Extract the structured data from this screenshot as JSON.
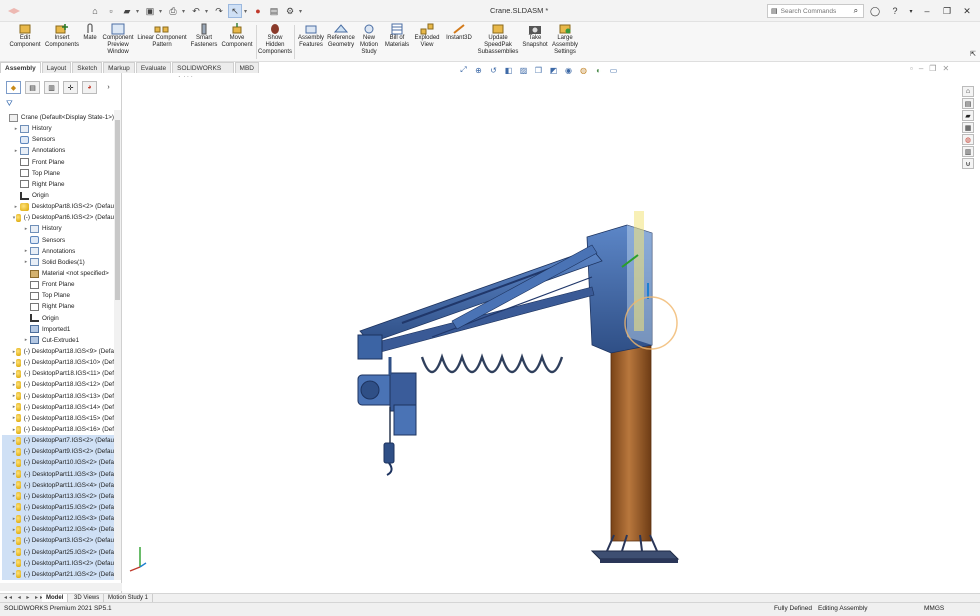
{
  "window": {
    "title": "Crane.SLDASM *"
  },
  "search": {
    "placeholder": "Search Commands"
  },
  "commands": [
    {
      "label": "Edit\nComponent"
    },
    {
      "label": "Insert\nComponents"
    },
    {
      "label": "Mate"
    },
    {
      "label": "Component\nPreview\nWindow"
    },
    {
      "label": "Linear Component\nPattern"
    },
    {
      "label": "Smart\nFasteners"
    },
    {
      "label": "Move\nComponent"
    },
    {
      "label": "Show\nHidden\nComponents"
    },
    {
      "label": "Assembly\nFeatures"
    },
    {
      "label": "Reference\nGeometry"
    },
    {
      "label": "New\nMotion\nStudy"
    },
    {
      "label": "Bill of\nMaterials"
    },
    {
      "label": "Exploded\nView"
    },
    {
      "label": "Instant3D"
    },
    {
      "label": "Update\nSpeedPak\nSubassemblies"
    },
    {
      "label": "Take\nSnapshot"
    },
    {
      "label": "Large\nAssembly\nSettings"
    }
  ],
  "tabs": [
    "Assembly",
    "Layout",
    "Sketch",
    "Markup",
    "Evaluate",
    "SOLIDWORKS Add-Ins",
    "MBD"
  ],
  "tree": [
    {
      "label": "Crane  (Default<Display State-1>)",
      "icon": "assembly",
      "exp": "",
      "indent": 0,
      "sel": false
    },
    {
      "label": "History",
      "icon": "folder",
      "exp": "▸",
      "indent": 1,
      "sel": false
    },
    {
      "label": "Sensors",
      "icon": "sensor",
      "exp": "",
      "indent": 1,
      "sel": false
    },
    {
      "label": "Annotations",
      "icon": "folder",
      "exp": "▸",
      "indent": 1,
      "sel": false
    },
    {
      "label": "Front Plane",
      "icon": "plane",
      "exp": "",
      "indent": 1,
      "sel": false
    },
    {
      "label": "Top Plane",
      "icon": "plane",
      "exp": "",
      "indent": 1,
      "sel": false
    },
    {
      "label": "Right Plane",
      "icon": "plane",
      "exp": "",
      "indent": 1,
      "sel": false
    },
    {
      "label": "Origin",
      "icon": "origin",
      "exp": "",
      "indent": 1,
      "sel": false
    },
    {
      "label": "DesktopPart8.IGS<2> (Defau",
      "icon": "part",
      "exp": "▸",
      "indent": 1,
      "sel": false
    },
    {
      "label": "(-) DesktopPart6.IGS<2> (Defau",
      "icon": "part",
      "exp": "▾",
      "indent": 1,
      "sel": false
    },
    {
      "label": "History",
      "icon": "folder",
      "exp": "▸",
      "indent": 2,
      "sel": false
    },
    {
      "label": "Sensors",
      "icon": "sensor",
      "exp": "",
      "indent": 2,
      "sel": false
    },
    {
      "label": "Annotations",
      "icon": "folder",
      "exp": "▸",
      "indent": 2,
      "sel": false
    },
    {
      "label": "Solid Bodies(1)",
      "icon": "folder",
      "exp": "▸",
      "indent": 2,
      "sel": false
    },
    {
      "label": "Material <not specified>",
      "icon": "mat",
      "exp": "",
      "indent": 2,
      "sel": false
    },
    {
      "label": "Front Plane",
      "icon": "plane",
      "exp": "",
      "indent": 2,
      "sel": false
    },
    {
      "label": "Top Plane",
      "icon": "plane",
      "exp": "",
      "indent": 2,
      "sel": false
    },
    {
      "label": "Right Plane",
      "icon": "plane",
      "exp": "",
      "indent": 2,
      "sel": false
    },
    {
      "label": "Origin",
      "icon": "origin",
      "exp": "",
      "indent": 2,
      "sel": false
    },
    {
      "label": "Imported1",
      "icon": "feat",
      "exp": "",
      "indent": 2,
      "sel": false
    },
    {
      "label": "Cut-Extrude1",
      "icon": "feat",
      "exp": "▸",
      "indent": 2,
      "sel": false
    },
    {
      "label": "(-) DesktopPart18.IGS<9> (Defa",
      "icon": "part",
      "exp": "▸",
      "indent": 1,
      "sel": false
    },
    {
      "label": "(-) DesktopPart18.IGS<10> (Def",
      "icon": "part",
      "exp": "▸",
      "indent": 1,
      "sel": false
    },
    {
      "label": "(-) DesktopPart18.IGS<11> (Def",
      "icon": "part",
      "exp": "▸",
      "indent": 1,
      "sel": false
    },
    {
      "label": "(-) DesktopPart18.IGS<12> (Def",
      "icon": "part",
      "exp": "▸",
      "indent": 1,
      "sel": false
    },
    {
      "label": "(-) DesktopPart18.IGS<13> (Def",
      "icon": "part",
      "exp": "▸",
      "indent": 1,
      "sel": false
    },
    {
      "label": "(-) DesktopPart18.IGS<14> (Def",
      "icon": "part",
      "exp": "▸",
      "indent": 1,
      "sel": false
    },
    {
      "label": "(-) DesktopPart18.IGS<15> (Def",
      "icon": "part",
      "exp": "▸",
      "indent": 1,
      "sel": false
    },
    {
      "label": "(-) DesktopPart18.IGS<16> (Def",
      "icon": "part",
      "exp": "▸",
      "indent": 1,
      "sel": false
    },
    {
      "label": "(-) DesktopPart7.IGS<2> (Defau",
      "icon": "part",
      "exp": "▸",
      "indent": 1,
      "sel": true
    },
    {
      "label": "(-) DesktopPart9.IGS<2> (Defau",
      "icon": "part",
      "exp": "▸",
      "indent": 1,
      "sel": true
    },
    {
      "label": "(-) DesktopPart10.IGS<2> (Defa",
      "icon": "part",
      "exp": "▸",
      "indent": 1,
      "sel": true
    },
    {
      "label": "(-) DesktopPart11.IGS<3> (Defa",
      "icon": "part",
      "exp": "▸",
      "indent": 1,
      "sel": true
    },
    {
      "label": "(-) DesktopPart11.IGS<4> (Defa",
      "icon": "part",
      "exp": "▸",
      "indent": 1,
      "sel": true
    },
    {
      "label": "(-) DesktopPart13.IGS<2> (Defa",
      "icon": "part",
      "exp": "▸",
      "indent": 1,
      "sel": true
    },
    {
      "label": "(-) DesktopPart15.IGS<2> (Defa",
      "icon": "part",
      "exp": "▸",
      "indent": 1,
      "sel": true
    },
    {
      "label": "(-) DesktopPart12.IGS<3> (Defa",
      "icon": "part",
      "exp": "▸",
      "indent": 1,
      "sel": true
    },
    {
      "label": "(-) DesktopPart12.IGS<4> (Defa",
      "icon": "part",
      "exp": "▸",
      "indent": 1,
      "sel": true
    },
    {
      "label": "(-) DesktopPart3.IGS<2> (Defau",
      "icon": "part",
      "exp": "▸",
      "indent": 1,
      "sel": true
    },
    {
      "label": "(-) DesktopPart25.IGS<2> (Defa",
      "icon": "part",
      "exp": "▸",
      "indent": 1,
      "sel": true
    },
    {
      "label": "(-) DesktopPart1.IGS<2> (Defau",
      "icon": "part",
      "exp": "▸",
      "indent": 1,
      "sel": true
    },
    {
      "label": "(-) DesktopPart21.IGS<2> (Defa",
      "icon": "part",
      "exp": "▸",
      "indent": 1,
      "sel": true
    }
  ],
  "bottom_tabs": [
    "Model",
    "3D Views",
    "Motion Study 1"
  ],
  "status": {
    "product": "SOLIDWORKS Premium 2021 SP5.1",
    "defined": "Fully Defined",
    "mode": "Editing Assembly",
    "units": "MMGS"
  },
  "colors": {
    "steel_blue": "#4a73b5",
    "column_brown": "#a0622e",
    "accent": "#1f5fbf"
  }
}
